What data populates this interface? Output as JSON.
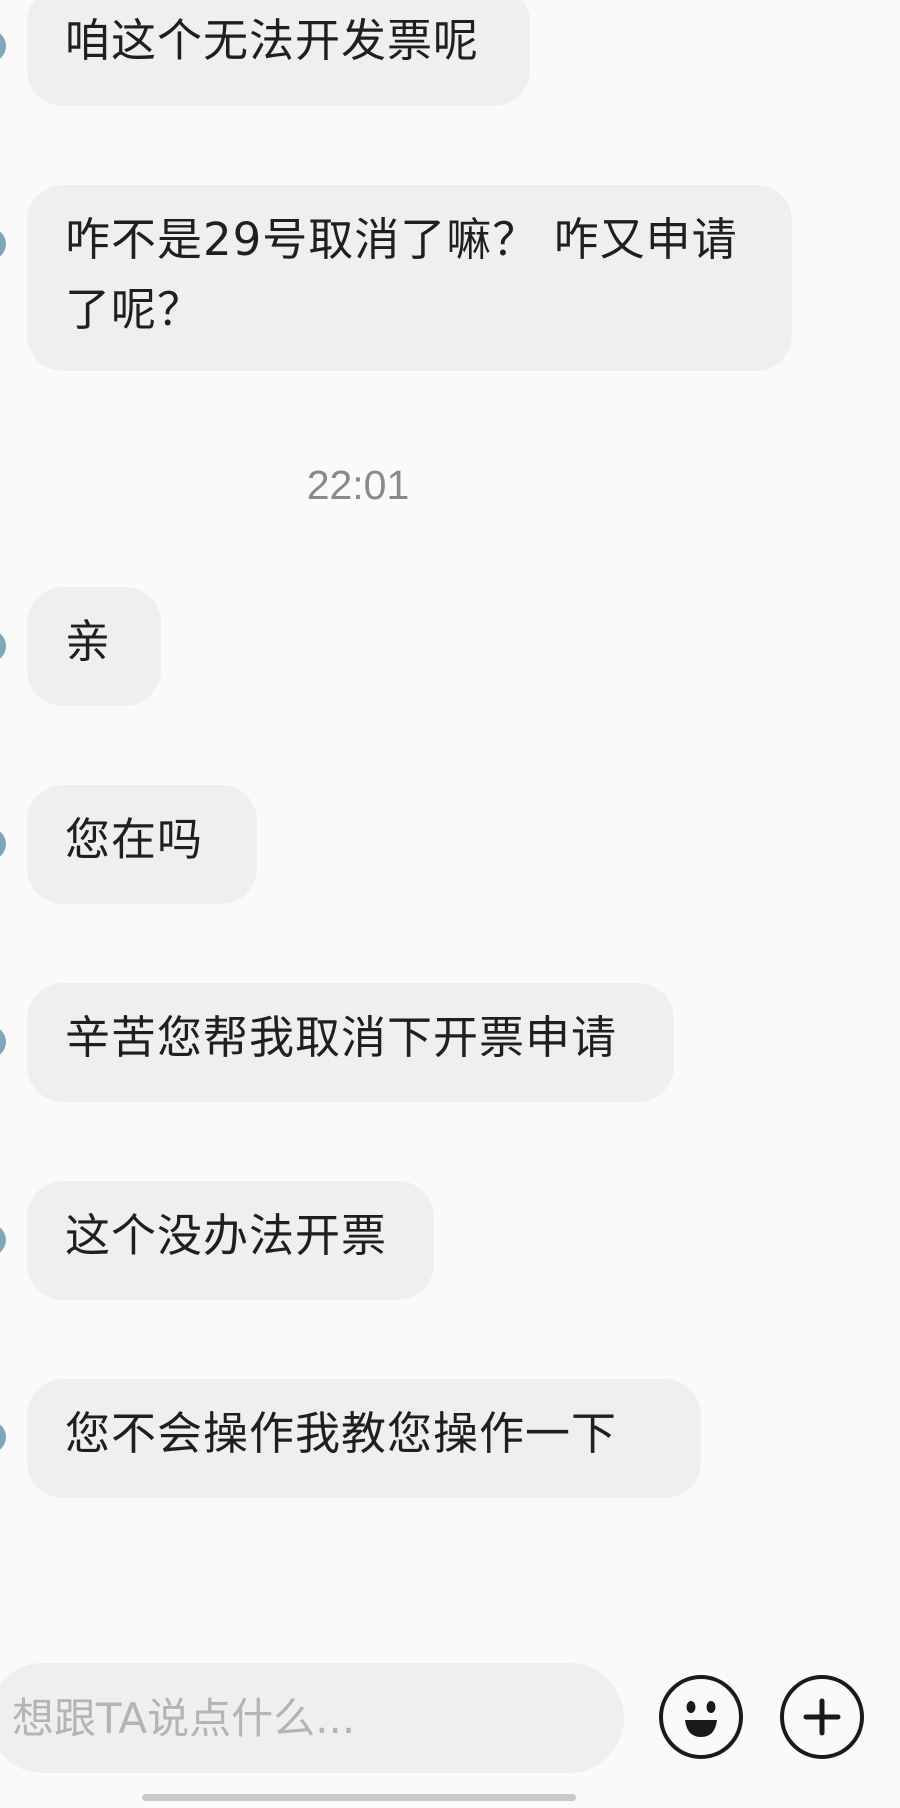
{
  "conversation": {
    "timestamp": "22:01",
    "messages_before_time": [
      {
        "text": "咱这个无法开发票呢"
      },
      {
        "text": "咋不是29号取消了嘛？ 咋又申请\n了呢？"
      }
    ],
    "messages_after_time": [
      {
        "text": "亲"
      },
      {
        "text": "您在吗"
      },
      {
        "text": "辛苦您帮我取消下开票申请"
      },
      {
        "text": "这个没办法开票"
      },
      {
        "text": "您不会操作我教您操作一下"
      }
    ]
  },
  "composer": {
    "placeholder": "想跟TA说点什么...",
    "emoji_icon": "smiley-face-icon",
    "add_icon": "plus-circle-icon"
  },
  "colors": {
    "bubble_bg": "#efeff0",
    "page_bg": "#fafafa",
    "timestamp_text": "#8a8a8a",
    "placeholder_text": "#b4b4b4"
  }
}
